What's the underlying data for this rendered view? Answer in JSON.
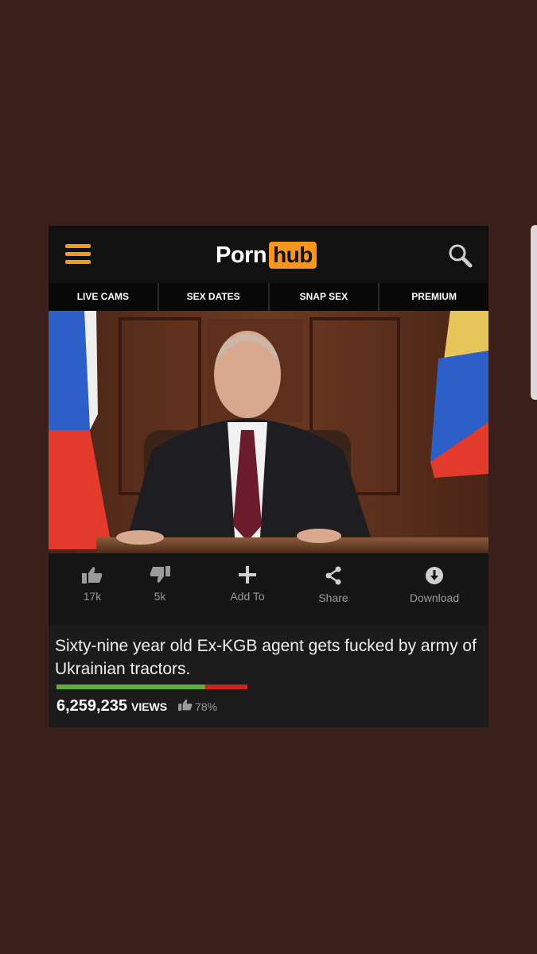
{
  "header": {
    "logo_left": "Porn",
    "logo_right": "hub",
    "menu_icon": "hamburger-menu-icon",
    "search_icon": "search-icon",
    "accent_color": "#f7971d"
  },
  "nav": {
    "items": [
      {
        "label": "LIVE CAMS"
      },
      {
        "label": "SEX DATES"
      },
      {
        "label": "SNAP SEX"
      },
      {
        "label": "PREMIUM"
      }
    ]
  },
  "actions": {
    "likes": "17k",
    "dislikes": "5k",
    "add_to": "Add To",
    "share": "Share",
    "download": "Download"
  },
  "video": {
    "title": "Sixty-nine year old Ex-KGB agent gets fucked by army of Ukrainian tractors.",
    "views_count": "6,259,235",
    "views_label": "VIEWS",
    "rating_percent": "78%",
    "rating_fraction": 0.78,
    "colors": {
      "positive": "#5cae35",
      "negative": "#c9271e"
    }
  }
}
